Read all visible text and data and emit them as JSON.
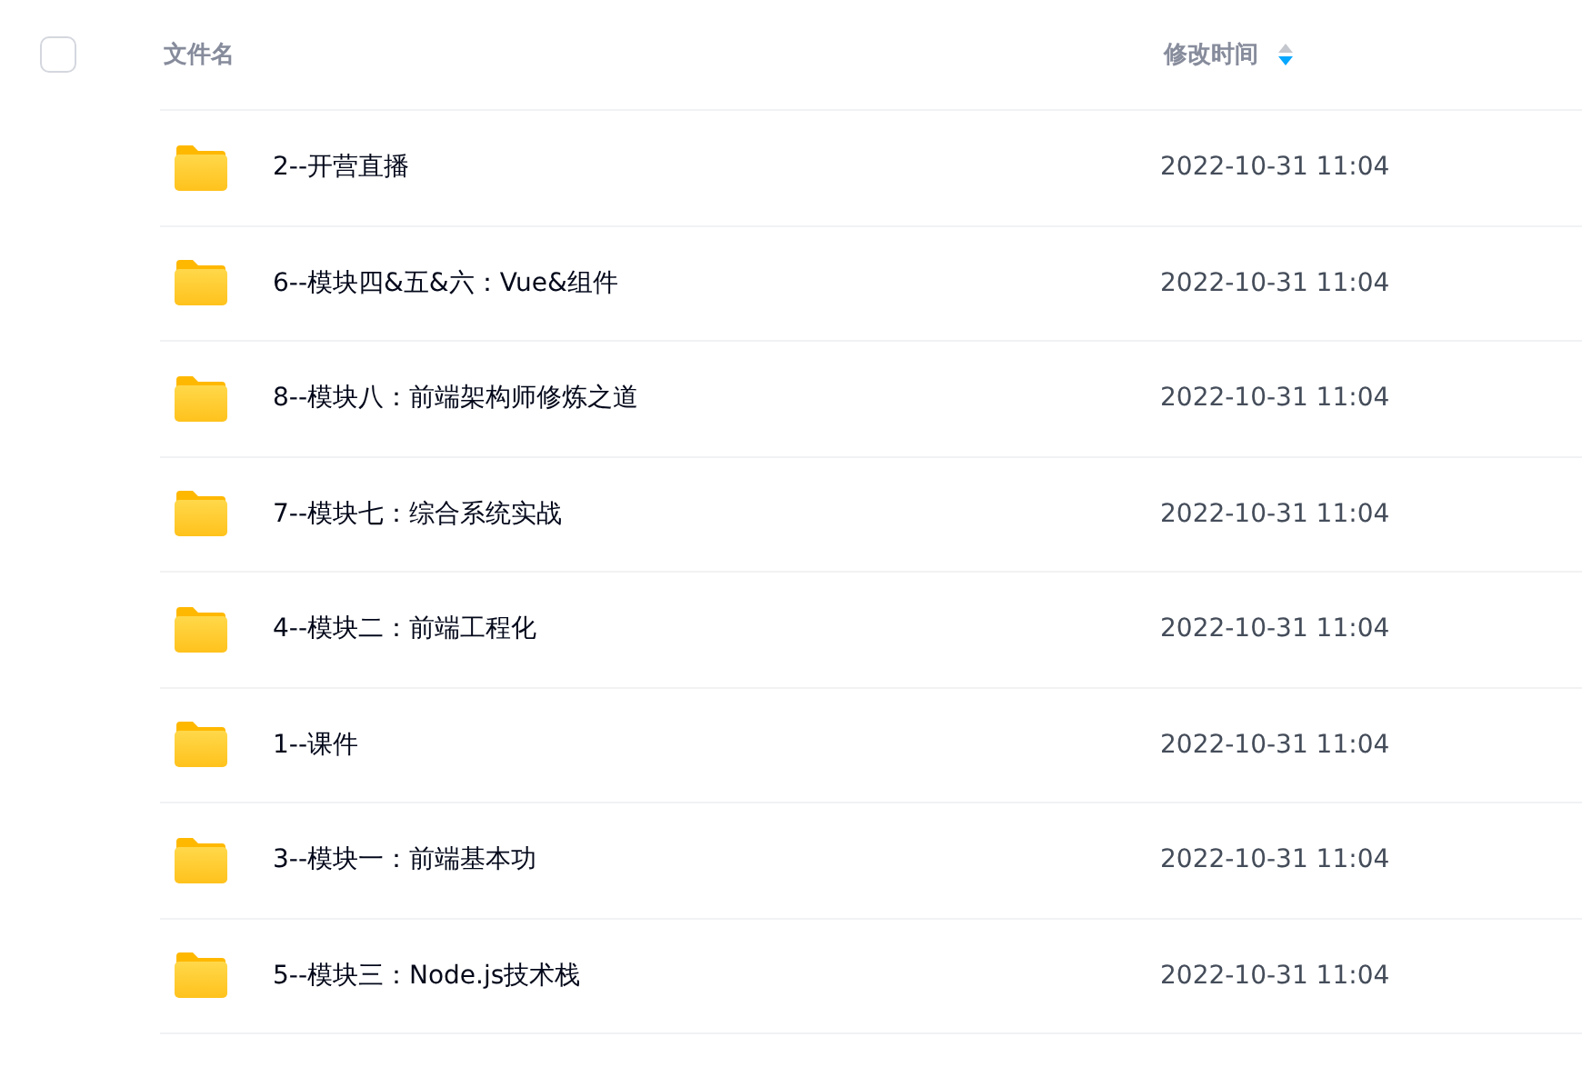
{
  "header": {
    "select_all_checked": false,
    "columns": [
      {
        "label": "文件名",
        "sorted": false
      },
      {
        "label": "修改时间",
        "sorted": true,
        "descending": true
      }
    ]
  },
  "rows": [
    {
      "name": "2--开营直播",
      "modified": "2022-10-31 11:04"
    },
    {
      "name": "6--模块四&五&六：Vue&组件",
      "modified": "2022-10-31 11:04"
    },
    {
      "name": "8--模块八：前端架构师修炼之道",
      "modified": "2022-10-31 11:04"
    },
    {
      "name": "7--模块七：综合系统实战",
      "modified": "2022-10-31 11:04"
    },
    {
      "name": "4--模块二：前端工程化",
      "modified": "2022-10-31 11:04"
    },
    {
      "name": "1--课件",
      "modified": "2022-10-31 11:04"
    },
    {
      "name": "3--模块一：前端基本功",
      "modified": "2022-10-31 11:04"
    },
    {
      "name": "5--模块三：Node.js技术栈",
      "modified": "2022-10-31 11:04"
    }
  ]
}
